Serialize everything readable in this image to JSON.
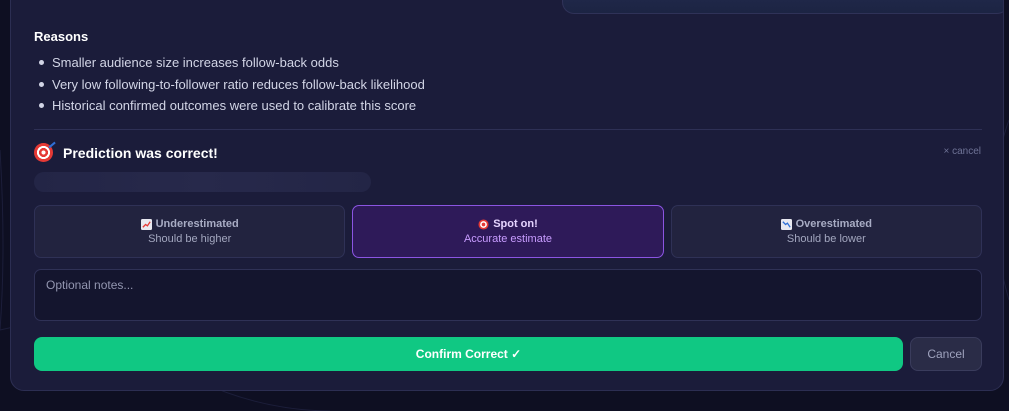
{
  "reasons": {
    "title": "Reasons",
    "items": [
      "Smaller audience size increases follow-back odds",
      "Very low following-to-follower ratio reduces follow-back likelihood",
      "Historical confirmed outcomes were used to calibrate this score"
    ]
  },
  "prediction": {
    "icon": "target-icon",
    "title": "Prediction was correct!",
    "cancel_label": "× cancel"
  },
  "options": [
    {
      "icon": "chart-up-icon",
      "title": "Underestimated",
      "subtitle": "Should be higher",
      "selected": false
    },
    {
      "icon": "target-icon",
      "title": "Spot on!",
      "subtitle": "Accurate estimate",
      "selected": true
    },
    {
      "icon": "chart-down-icon",
      "title": "Overestimated",
      "subtitle": "Should be lower",
      "selected": false
    }
  ],
  "notes": {
    "placeholder": "Optional notes...",
    "value": ""
  },
  "actions": {
    "confirm_label": "Confirm Correct ✓",
    "cancel_label": "Cancel"
  },
  "colors": {
    "background": "#0e0f22",
    "card": "#1b1c3a",
    "accent_green": "#10c883",
    "selected_purple": "#8b55e2"
  }
}
